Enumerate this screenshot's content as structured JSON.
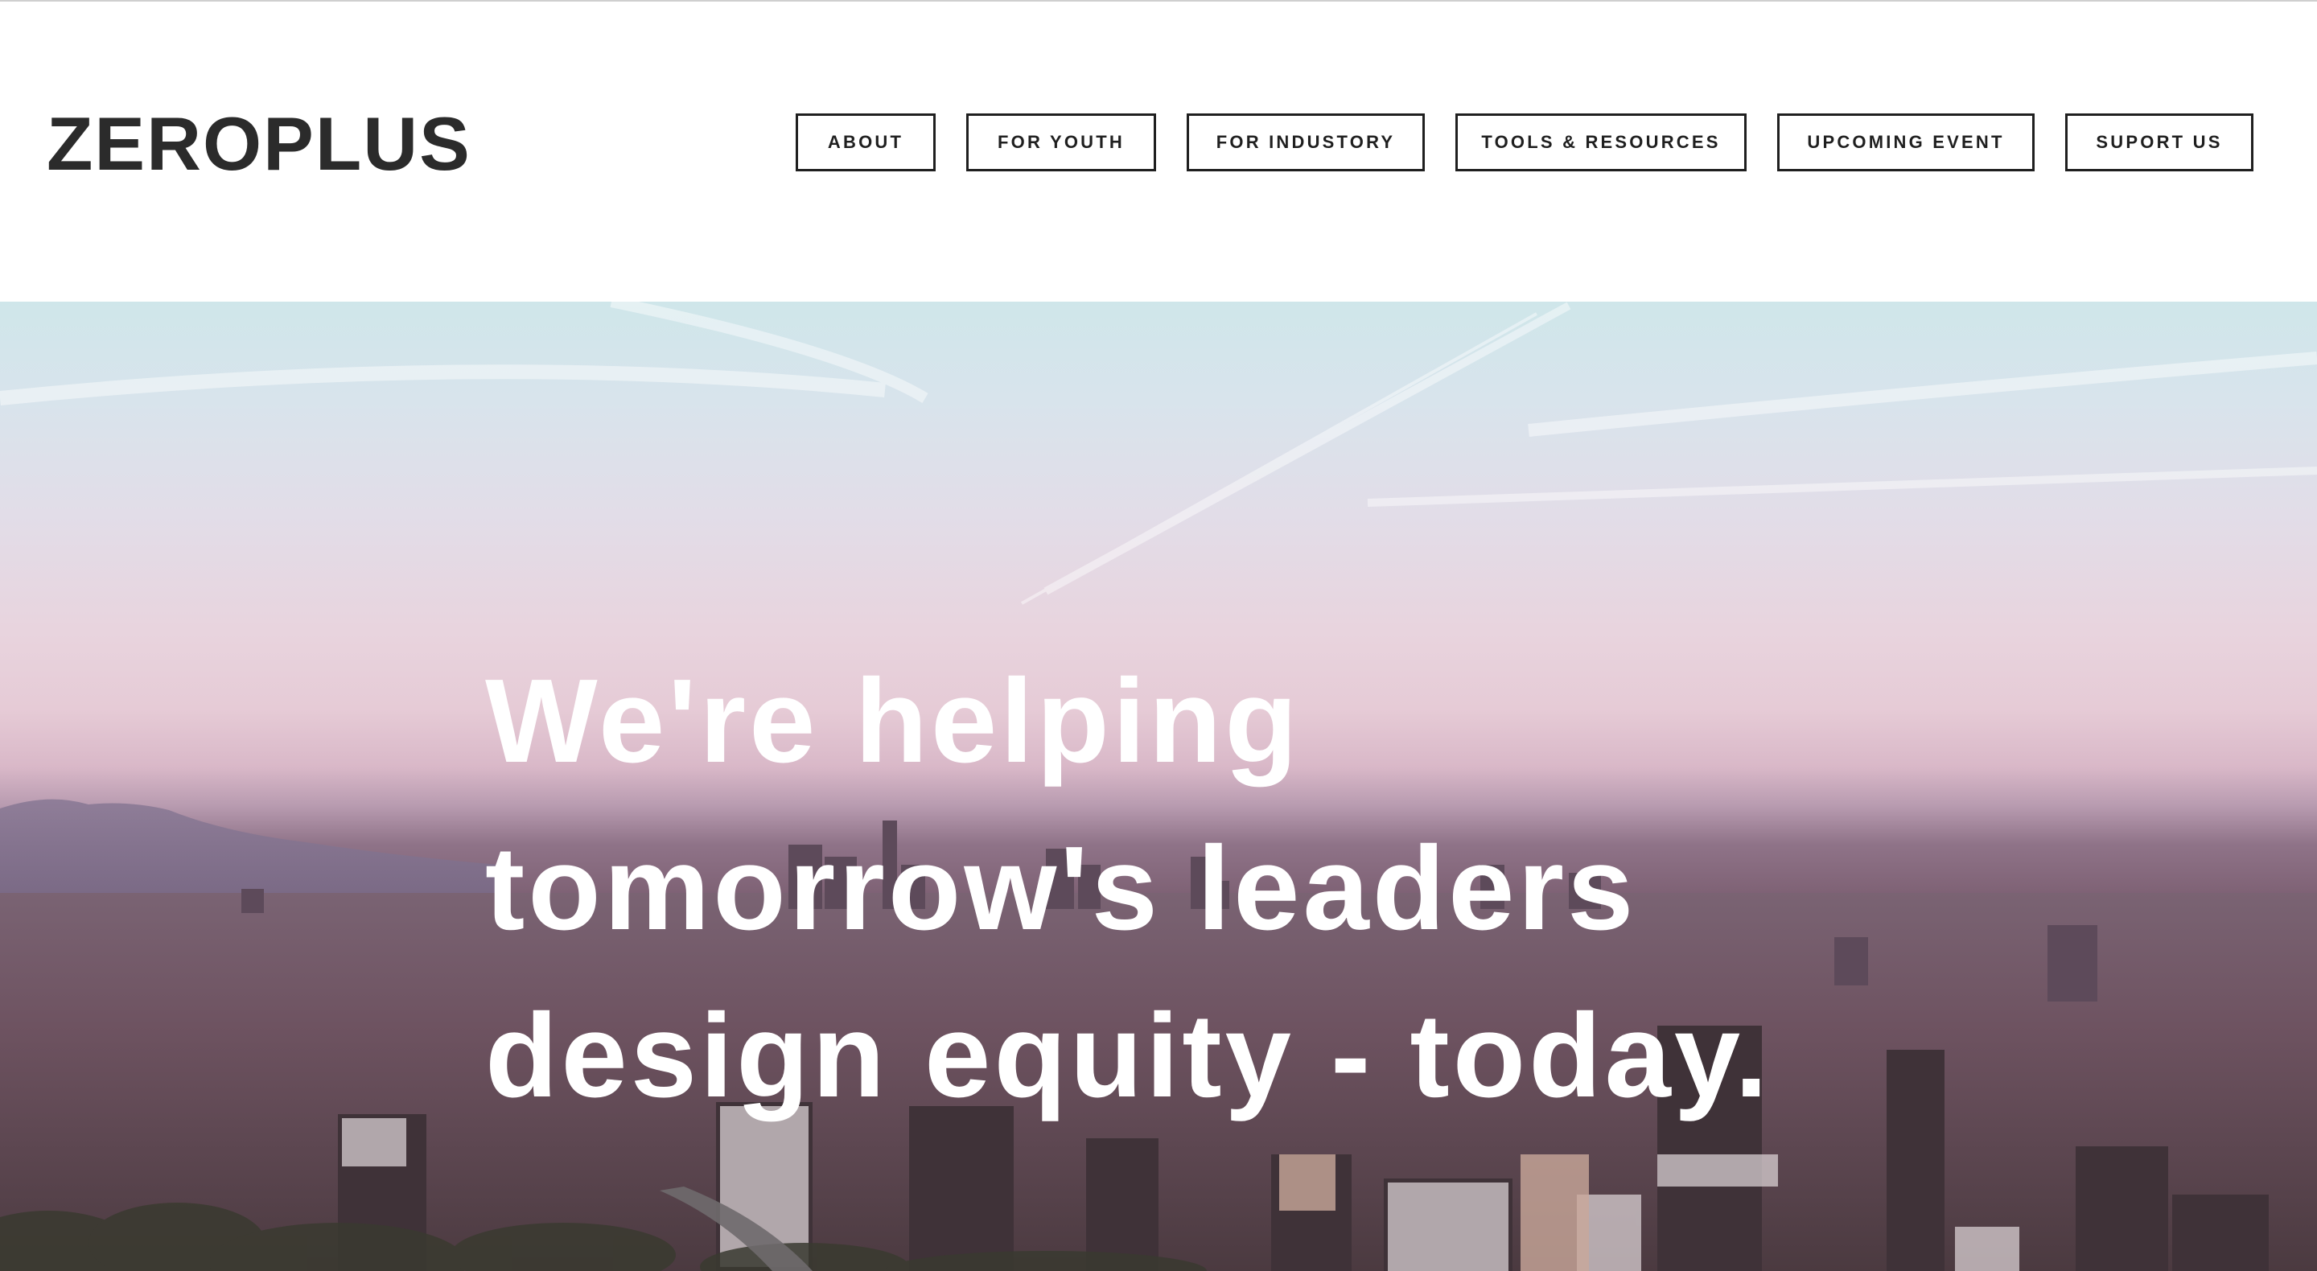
{
  "brand": {
    "logo_text": "ZEROPLUS"
  },
  "nav": {
    "items": [
      {
        "label": "ABOUT"
      },
      {
        "label": "FOR YOUTH"
      },
      {
        "label": "FOR INDUSTORY"
      },
      {
        "label": "TOOLS & RESOURCES"
      },
      {
        "label": "UPCOMING EVENT"
      },
      {
        "label": "SUPORT US"
      }
    ]
  },
  "hero": {
    "headline_lines": [
      "We're helping",
      "tomorrow's leaders",
      "design equity - today."
    ],
    "background_image": "aerial-city-skyline-at-dusk"
  },
  "colors": {
    "text_dark": "#2b2b2b",
    "nav_border": "#1f1f1f",
    "headline": "#ffffff",
    "header_background": "#ffffff"
  }
}
